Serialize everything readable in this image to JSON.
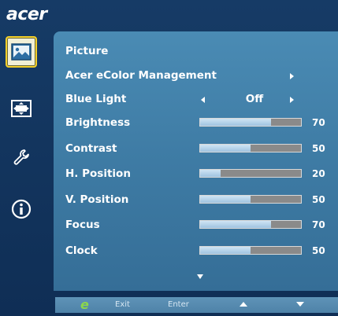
{
  "brand": "acer",
  "sidebar": {
    "items": [
      {
        "icon": "picture-icon",
        "active": true
      },
      {
        "icon": "position-icon",
        "active": false
      },
      {
        "icon": "wrench-icon",
        "active": false
      },
      {
        "icon": "info-icon",
        "active": false
      }
    ]
  },
  "menu": {
    "section_title": "Picture",
    "ecolor_label": "Acer eColor Management",
    "blue_light": {
      "label": "Blue Light",
      "value": "Off"
    },
    "settings": [
      {
        "label": "Brightness",
        "value": 70
      },
      {
        "label": "Contrast",
        "value": 50
      },
      {
        "label": "H. Position",
        "value": 20
      },
      {
        "label": "V. Position",
        "value": 50
      },
      {
        "label": "Focus",
        "value": 70
      },
      {
        "label": "Clock",
        "value": 50
      }
    ]
  },
  "footer": {
    "exit_label": "Exit",
    "enter_label": "Enter"
  },
  "colors": {
    "accent": "#f3cf2a",
    "panel": "#4a8bb4",
    "background": "#163b66",
    "slider_fill": "#9fc3e0"
  }
}
